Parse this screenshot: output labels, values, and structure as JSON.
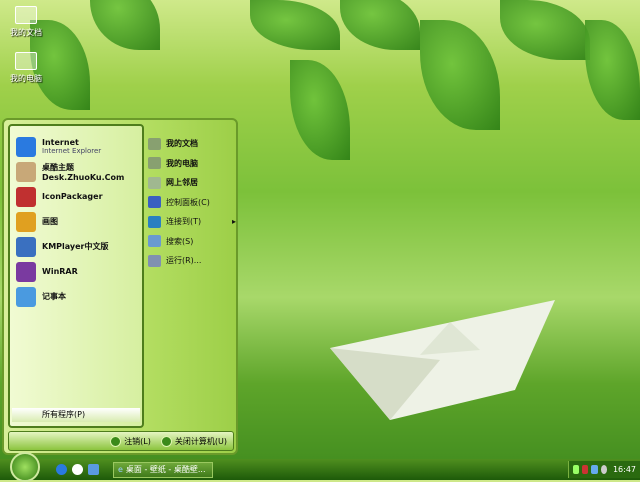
{
  "desktop_icons": [
    {
      "label": "我的文档"
    },
    {
      "label": "我的电脑"
    }
  ],
  "start_menu": {
    "programs": [
      {
        "label": "Internet",
        "sublabel": "Internet Explorer",
        "color": "#2a7ae0"
      },
      {
        "label": "桌酷主题Desk.ZhuoKu.Com",
        "color": "#c8a878"
      },
      {
        "label": "IconPackager",
        "color": "#c03030"
      },
      {
        "label": "画图",
        "color": "#e0a020"
      },
      {
        "label": "KMPlayer中文版",
        "color": "#3a70c0"
      },
      {
        "label": "WinRAR",
        "color": "#7a3aa0"
      },
      {
        "label": "记事本",
        "color": "#4a9ae0"
      }
    ],
    "all_programs": "所有程序(P)",
    "places": [
      {
        "label": "我的文档",
        "bold": true,
        "color": "#88a070"
      },
      {
        "label": "我的电脑",
        "bold": true,
        "color": "#88a070"
      },
      {
        "label": "网上邻居",
        "bold": true,
        "color": "#a0b890"
      },
      {
        "label": "控制面板(C)",
        "color": "#3a60c0"
      },
      {
        "label": "连接到(T)",
        "color": "#2a80c0",
        "arrow": "▸"
      },
      {
        "label": "搜索(S)",
        "color": "#6a9ad0"
      },
      {
        "label": "运行(R)...",
        "color": "#8090b0"
      }
    ],
    "logoff": "注销(L)",
    "shutdown": "关闭计算机(U)"
  },
  "taskbar": {
    "task_label": "桌面 - 壁纸 - 桌酷壁...",
    "clock": "16:47"
  }
}
